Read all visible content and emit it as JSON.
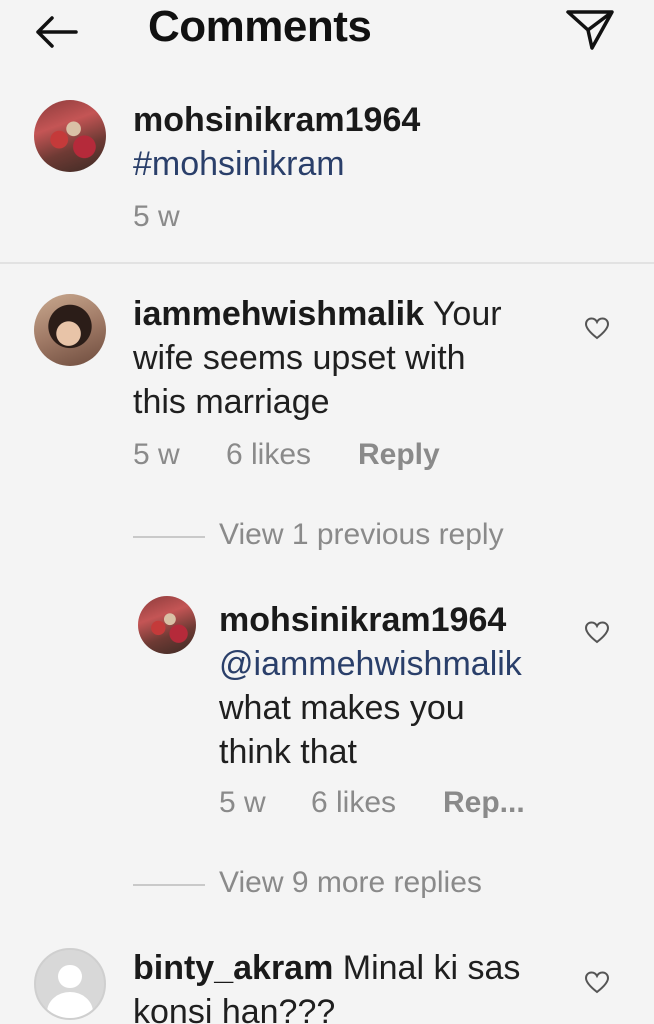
{
  "header": {
    "title": "Comments",
    "back_icon": "arrow-left-icon",
    "share_icon": "paper-plane-icon"
  },
  "caption": {
    "username": "mohsinikram1964",
    "text": "#mohsinikram",
    "time": "5 w"
  },
  "comments": [
    {
      "username": "iammehwishmalik",
      "text_line1_rest": " Your",
      "text_line2": "wife seems upset with",
      "text_line3": "this marriage",
      "time": "5 w",
      "likes": "6 likes",
      "reply": "Reply"
    }
  ],
  "view_previous": "View 1 previous reply",
  "reply_comment": {
    "username": "mohsinikram1964",
    "mention": "@iammehwishmalik",
    "text_line1": "what makes you",
    "text_line2": "think that",
    "time": "5 w",
    "likes": "6 likes",
    "reply": "Rep..."
  },
  "view_more": "View 9 more replies",
  "last_comment": {
    "username": "binty_akram",
    "text_line1_rest": " Minal ki sas",
    "text_line2": "konsi han???"
  },
  "colors": {
    "background": "#f4f4f4",
    "mention": "#2a3f6a",
    "meta": "#8a8a8a"
  }
}
